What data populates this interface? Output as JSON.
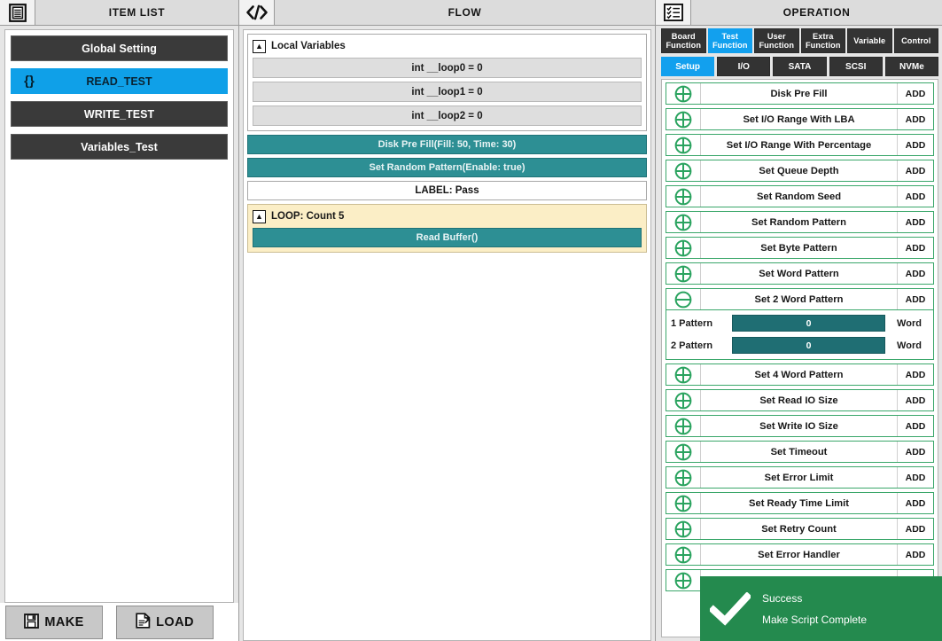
{
  "panels": {
    "item_list": {
      "title": "ITEM LIST",
      "icon": "clipboard-list-icon"
    },
    "flow": {
      "title": "FLOW",
      "icon": "code-brackets-icon"
    },
    "operation": {
      "title": "OPERATION",
      "icon": "checklist-icon"
    }
  },
  "colors": {
    "accent_blue": "#12a0ee",
    "teal_block": "#2d8f94",
    "loop_yellow": "#fbeec6",
    "op_green": "#3aa76a",
    "toast_green": "#248a4e",
    "dark_tab": "#333333",
    "param_field": "#1f6e73"
  },
  "item_list": {
    "items": [
      {
        "label": "Global Setting",
        "icon": "",
        "selected": false
      },
      {
        "label": "READ_TEST",
        "icon": "{}",
        "selected": true
      },
      {
        "label": "WRITE_TEST",
        "icon": "",
        "selected": false
      },
      {
        "label": "Variables_Test",
        "icon": "",
        "selected": false
      }
    ]
  },
  "bottom_bar": {
    "make_label": "MAKE",
    "make_icon": "save-floppy-icon",
    "load_label": "LOAD",
    "load_icon": "load-document-icon"
  },
  "flow": {
    "local_variables": {
      "title": "Local Variables",
      "expanded": true,
      "caret": "▲",
      "variables": [
        "int __loop0 = 0",
        "int __loop1 = 0",
        "int __loop2 = 0"
      ]
    },
    "statements": [
      {
        "kind": "op",
        "text": "Disk Pre Fill(Fill: 50, Time: 30)"
      },
      {
        "kind": "op",
        "text": "Set Random Pattern(Enable: true)"
      },
      {
        "kind": "label",
        "text": "LABEL: Pass"
      }
    ],
    "loop": {
      "title": "LOOP: Count 5",
      "caret": "▲",
      "children": [
        {
          "kind": "op",
          "text": "Read Buffer()"
        }
      ]
    }
  },
  "operation": {
    "primary_tabs": [
      {
        "line1": "Board",
        "line2": "Function",
        "active": false
      },
      {
        "line1": "Test",
        "line2": "Function",
        "active": true
      },
      {
        "line1": "User",
        "line2": "Function",
        "active": false
      },
      {
        "line1": "Extra",
        "line2": "Function",
        "active": false
      },
      {
        "line1": "Variable",
        "line2": "",
        "active": false
      },
      {
        "line1": "Control",
        "line2": "",
        "active": false
      }
    ],
    "secondary_tabs": [
      {
        "label": "Setup",
        "active": true
      },
      {
        "label": "I/O",
        "active": false
      },
      {
        "label": "SATA",
        "active": false
      },
      {
        "label": "SCSI",
        "active": false
      },
      {
        "label": "NVMe",
        "active": false
      }
    ],
    "add_label": "ADD",
    "rows": [
      {
        "name": "Disk Pre Fill",
        "state": "collapsed"
      },
      {
        "name": "Set I/O Range With LBA",
        "state": "collapsed"
      },
      {
        "name": "Set I/O Range With Percentage",
        "state": "collapsed"
      },
      {
        "name": "Set Queue Depth",
        "state": "collapsed"
      },
      {
        "name": "Set Random Seed",
        "state": "collapsed"
      },
      {
        "name": "Set Random Pattern",
        "state": "collapsed"
      },
      {
        "name": "Set Byte Pattern",
        "state": "collapsed"
      },
      {
        "name": "Set Word Pattern",
        "state": "collapsed"
      },
      {
        "name": "Set 2 Word Pattern",
        "state": "expanded",
        "params": [
          {
            "label": "1 Pattern",
            "value": "0",
            "unit": "Word"
          },
          {
            "label": "2 Pattern",
            "value": "0",
            "unit": "Word"
          }
        ]
      },
      {
        "name": "Set 4 Word Pattern",
        "state": "collapsed"
      },
      {
        "name": "Set Read IO Size",
        "state": "collapsed"
      },
      {
        "name": "Set Write IO Size",
        "state": "collapsed"
      },
      {
        "name": "Set Timeout",
        "state": "collapsed"
      },
      {
        "name": "Set Error Limit",
        "state": "collapsed"
      },
      {
        "name": "Set Ready Time Limit",
        "state": "collapsed"
      },
      {
        "name": "Set Retry Count",
        "state": "collapsed"
      },
      {
        "name": "Set Error Handler",
        "state": "collapsed"
      },
      {
        "name": "",
        "state": "collapsed"
      }
    ]
  },
  "toast": {
    "title": "Success",
    "message": "Make Script Complete",
    "icon": "check-icon"
  }
}
